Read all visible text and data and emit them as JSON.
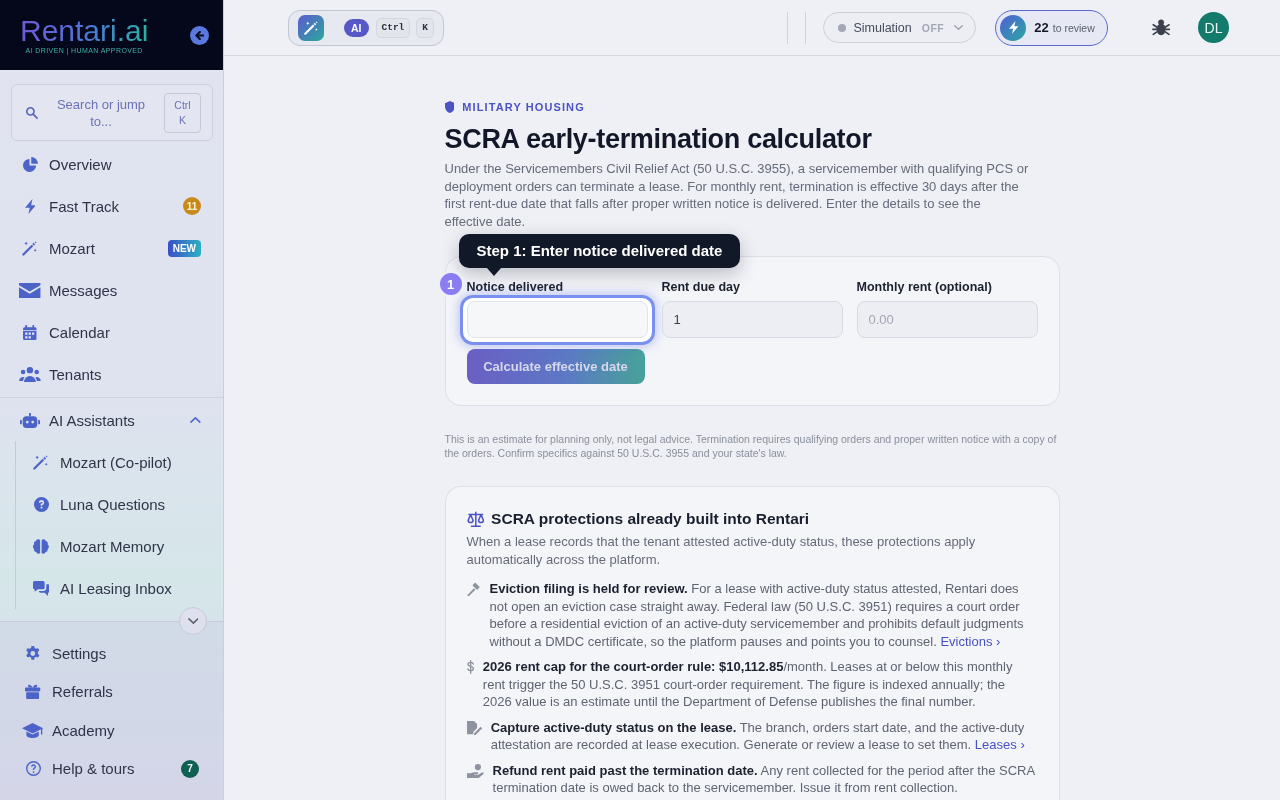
{
  "sidebar": {
    "logo": {
      "name": "Rentari.ai",
      "tagline": "AI DRIVEN | HUMAN APPROVED"
    },
    "search": {
      "label": "Search or jump to...",
      "shortcut": "Ctrl K"
    },
    "nav": [
      {
        "label": "Overview",
        "selected": false
      },
      {
        "label": "Fast Track",
        "selected": false,
        "badge": {
          "text": "11",
          "kind": "alert"
        }
      },
      {
        "label": "Mozart",
        "selected": false,
        "badge": {
          "text": "NEW",
          "kind": "new"
        }
      },
      {
        "label": "Messages",
        "selected": false
      },
      {
        "label": "Calendar",
        "selected": false
      },
      {
        "label": "Tenants",
        "selected": false
      },
      {
        "label": "AI Assistants",
        "selected": false,
        "expanded": true,
        "children": [
          {
            "label": "Mozart (Co-pilot)",
            "selected": false
          },
          {
            "label": "Luna Questions",
            "selected": false
          },
          {
            "label": "Mozart Memory",
            "selected": false
          },
          {
            "label": "AI Leasing Inbox",
            "selected": false
          }
        ]
      }
    ],
    "footer_nav": [
      {
        "label": "Settings",
        "selected": false
      },
      {
        "label": "Referrals",
        "selected": false
      },
      {
        "label": "Academy",
        "selected": false
      },
      {
        "label": "Help & tours",
        "selected": false,
        "badge": {
          "text": "7",
          "kind": "count"
        }
      }
    ]
  },
  "topbar": {
    "assistant": {
      "label": "AI",
      "keys": [
        "Ctrl",
        "K"
      ]
    },
    "simulation": {
      "label": "Simulation",
      "state": "OFF",
      "on": false
    },
    "review": {
      "count": "22",
      "label": "to review"
    },
    "avatar": "DL"
  },
  "page": {
    "eyebrow": "MILITARY HOUSING",
    "title": "SCRA early-termination calculator",
    "intro": "Under the Servicemembers Civil Relief Act (50 U.S.C. 3955), a servicemember with qualifying PCS or deployment orders can terminate a lease. For monthly rent, termination is effective 30 days after the first rent-due date that falls after proper written notice is delivered. Enter the details to see the effective date.",
    "calculator": {
      "fields": [
        {
          "label": "Notice delivered",
          "spotlight": true
        },
        {
          "label": "Rent due day",
          "value": "1",
          "spotlight": false
        },
        {
          "label": "Monthly rent (optional)",
          "placeholder": "0.00",
          "spotlight": false
        }
      ],
      "button": {
        "label": "Calculate effective date",
        "disabled": true
      }
    },
    "tour": {
      "step": "1",
      "text": "Step 1: Enter notice delivered date"
    },
    "disclaimer": "This is an estimate for planning only, not legal advice. Termination requires qualifying orders and proper written notice with a copy of the orders. Confirm specifics against 50 U.S.C. 3955 and your state's law.",
    "protections": {
      "title": "SCRA protections already built into Rentari",
      "intro": "When a lease records that the tenant attested active-duty status, these protections apply automatically across the platform.",
      "items": [
        {
          "text": "**Eviction filing is held for review.** For a lease with active-duty status attested, Rentari does not open an eviction case straight away. Federal law (50 U.S.C. 3951) requires a court order before a residential eviction of an active-duty servicemember and prohibits default judgments without a DMDC certificate, so the platform pauses and points you to counsel.",
          "link": "Evictions ›"
        },
        {
          "text": "**2026 rent cap for the court-order rule: $10,112.85**/month. Leases at or below this monthly rent trigger the 50 U.S.C. 3951 court-order requirement. The figure is indexed annually; the 2026 value is an estimate until the Department of Defense publishes the final number."
        },
        {
          "text": "**Capture active-duty status on the lease.** The branch, orders start date, and the active-duty attestation are recorded at lease execution. Generate or review a lease to set them.",
          "link": "Leases ›"
        },
        {
          "text": "**Refund rent paid past the termination date.** Any rent collected for the period after the SCRA termination date is owed back to the servicemember. Issue it from rent collection."
        }
      ]
    }
  }
}
